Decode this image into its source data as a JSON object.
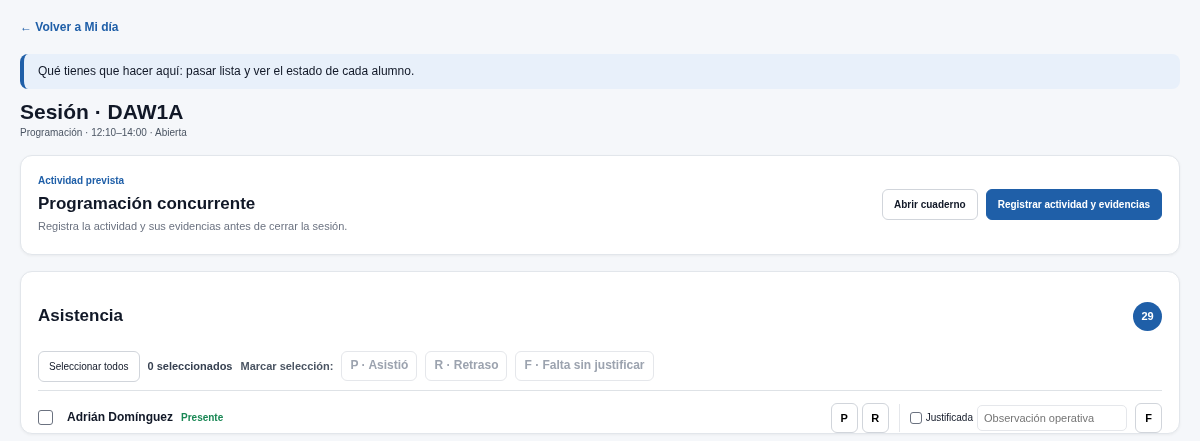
{
  "back_link": "← Volver a Mi día",
  "help": "Qué tienes que hacer aquí: pasar lista y ver el estado de cada alumno.",
  "session": {
    "title": "Sesión · DAW1A",
    "meta": "Programación · 12:10–14:00 · Abierta"
  },
  "activity": {
    "eyebrow": "Actividad prevista",
    "title": "Programación concurrente",
    "note": "Registra la actividad y sus evidencias antes de cerrar la sesión.",
    "buttons": [
      {
        "label": "Abrir cuaderno",
        "kind": "secondary"
      },
      {
        "label": "Registrar actividad y evidencias",
        "kind": "primary"
      }
    ]
  },
  "attendance": {
    "title": "Asistencia",
    "count": "29",
    "select_all": "Seleccionar todos",
    "selected_count": "0 seleccionados",
    "mark_label": "Marcar selección:",
    "bulk_actions": [
      {
        "label": "P · Asistió",
        "disabled": true
      },
      {
        "label": "R · Retraso",
        "disabled": true
      },
      {
        "label": "F · Falta sin justificar",
        "disabled": true
      }
    ],
    "students": [
      {
        "name": "Adrián Domínguez",
        "checked": false,
        "status": "Presente",
        "color": "#198754",
        "marks": [
          "P",
          "R"
        ],
        "justified_label": "Justificada",
        "justified": false,
        "observation_placeholder": "Observación operativa",
        "last_mark": "F"
      }
    ]
  }
}
